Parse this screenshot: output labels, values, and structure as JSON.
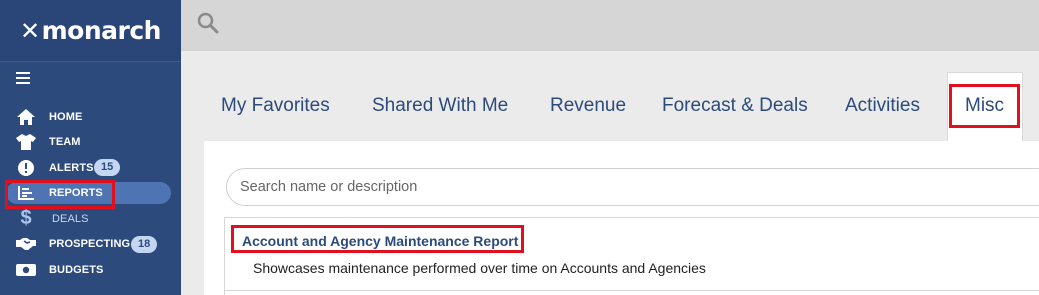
{
  "app": {
    "logo_text": "monarch"
  },
  "sidebar": {
    "items": [
      {
        "label": "HOME",
        "icon": "home-icon"
      },
      {
        "label": "TEAM",
        "icon": "shirt-icon"
      },
      {
        "label": "ALERTS",
        "icon": "alert-icon",
        "badge": "15"
      },
      {
        "label": "REPORTS",
        "icon": "reports-icon",
        "active": true
      },
      {
        "label": "DEALS",
        "icon": "dollar-icon"
      },
      {
        "label": "PROSPECTING",
        "icon": "handshake-icon",
        "badge": "18"
      },
      {
        "label": "BUDGETS",
        "icon": "money-icon"
      }
    ]
  },
  "tabs": [
    {
      "label": "My Favorites"
    },
    {
      "label": "Shared With Me"
    },
    {
      "label": "Revenue"
    },
    {
      "label": "Forecast & Deals"
    },
    {
      "label": "Activities"
    },
    {
      "label": "Misc",
      "active": true
    }
  ],
  "search": {
    "placeholder": "Search name or description"
  },
  "report": {
    "title": "Account and Agency Maintenance Report",
    "description": "Showcases maintenance performed over time on Accounts and Agencies"
  },
  "colors": {
    "sidebar": "#2c4a7c",
    "accent": "#4f74b3",
    "highlight": "#e0101f"
  }
}
